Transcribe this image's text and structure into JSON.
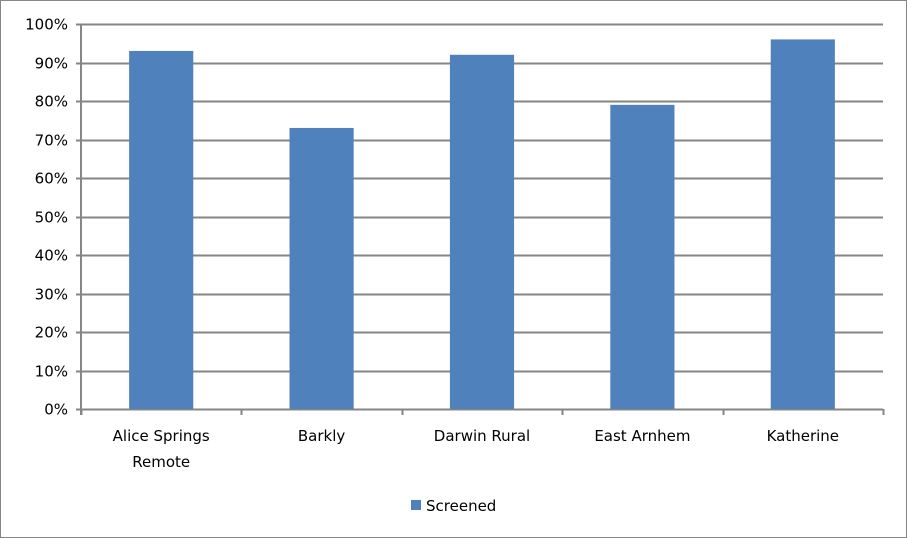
{
  "chart_data": {
    "type": "bar",
    "title": "",
    "xlabel": "",
    "ylabel": "",
    "categories": [
      [
        "Alice Springs",
        "Remote"
      ],
      [
        "Barkly"
      ],
      [
        "Darwin Rural"
      ],
      [
        "East Arnhem"
      ],
      [
        "Katherine"
      ]
    ],
    "series": [
      {
        "name": "Screened",
        "color": "#4f81bd",
        "values": [
          93,
          73,
          92,
          79,
          96
        ]
      }
    ],
    "ylim": [
      0,
      100
    ],
    "yticks": [
      0,
      10,
      20,
      30,
      40,
      50,
      60,
      70,
      80,
      90,
      100
    ],
    "ytick_format": "{v}%",
    "grid": true,
    "legend": "bottom"
  },
  "colors": {
    "grid": "#868686",
    "axis": "#868686",
    "bar": "#4f81bd"
  }
}
